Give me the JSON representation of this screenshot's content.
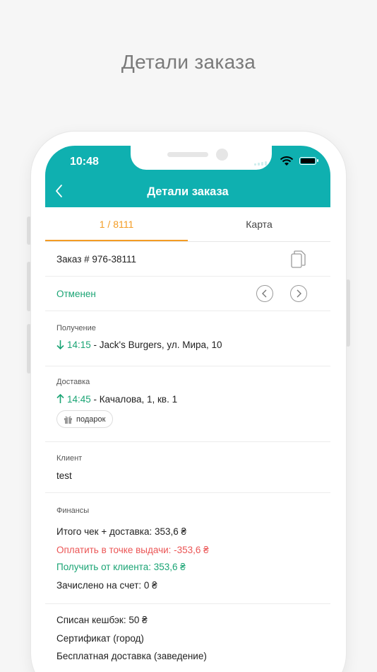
{
  "caption": "Детали заказа",
  "status_bar": {
    "time": "10:48"
  },
  "appbar": {
    "title": "Детали заказа"
  },
  "tabs": [
    {
      "label": "1 / 8111",
      "active": true
    },
    {
      "label": "Карта",
      "active": false
    }
  ],
  "order": {
    "number_label": "Заказ # 976-38111",
    "status": "Отменен"
  },
  "pickup": {
    "label": "Получение",
    "time": "14:15",
    "place": " - Jack's Burgers, ул. Мира, 10"
  },
  "delivery": {
    "label": "Доставка",
    "time": "14:45",
    "address": " - Качалова, 1, кв. 1",
    "tag": "подарок"
  },
  "client": {
    "label": "Клиент",
    "name": "test"
  },
  "finance": {
    "label": "Финансы",
    "total": "Итого чек + доставка: 353,6 ₴",
    "pay_at_pickup": "Оплатить в точке выдачи: -353,6 ₴",
    "receive_from_client": "Получить от клиента: 353,6 ₴",
    "credited": "Зачислено на счет: 0 ₴"
  },
  "extras": {
    "cashback": "Списан кешбэк: 50 ₴",
    "certificate": "Сертификат (город)",
    "free_delivery": "Бесплатная доставка (заведение)"
  },
  "colors": {
    "accent": "#0fb0b0",
    "tab_active": "#f39c24",
    "green": "#1aa474",
    "red": "#eb5555"
  }
}
